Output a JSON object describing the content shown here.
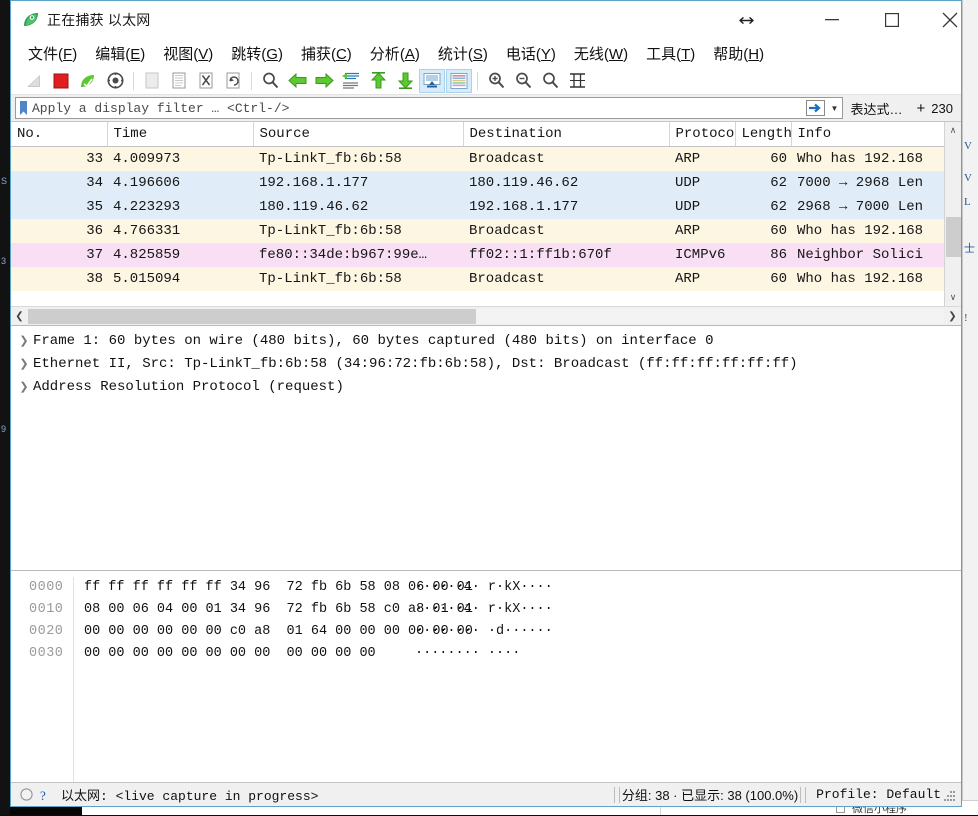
{
  "window": {
    "title": "正在捕获 以太网",
    "app_icon": "wireshark-fin-icon",
    "controls": {
      "resize": "↔",
      "minimize": "—",
      "maximize": "□",
      "close": "✕"
    }
  },
  "menubar": [
    {
      "label": "文件",
      "accel": "F"
    },
    {
      "label": "编辑",
      "accel": "E"
    },
    {
      "label": "视图",
      "accel": "V"
    },
    {
      "label": "跳转",
      "accel": "G"
    },
    {
      "label": "捕获",
      "accel": "C"
    },
    {
      "label": "分析",
      "accel": "A"
    },
    {
      "label": "统计",
      "accel": "S"
    },
    {
      "label": "电话",
      "accel": "Y"
    },
    {
      "label": "无线",
      "accel": "W"
    },
    {
      "label": "工具",
      "accel": "T"
    },
    {
      "label": "帮助",
      "accel": "H"
    }
  ],
  "toolbar": [
    {
      "name": "start-capture-icon",
      "disabled": true
    },
    {
      "name": "stop-capture-icon",
      "disabled": false
    },
    {
      "name": "restart-capture-icon",
      "disabled": false
    },
    {
      "name": "capture-options-icon",
      "disabled": false
    },
    {
      "name": "open-file-icon",
      "disabled": true
    },
    {
      "name": "save-file-icon",
      "disabled": false
    },
    {
      "name": "close-file-icon",
      "disabled": false
    },
    {
      "name": "reload-file-icon",
      "disabled": false
    },
    {
      "name": "find-packet-icon",
      "disabled": false
    },
    {
      "name": "go-back-icon",
      "disabled": false
    },
    {
      "name": "go-forward-icon",
      "disabled": false
    },
    {
      "name": "go-to-packet-icon",
      "disabled": false
    },
    {
      "name": "go-first-packet-icon",
      "disabled": false
    },
    {
      "name": "go-last-packet-icon",
      "disabled": false
    },
    {
      "name": "auto-scroll-icon",
      "selected": true
    },
    {
      "name": "colorize-packets-icon",
      "selected": true
    },
    {
      "name": "zoom-in-icon",
      "disabled": false
    },
    {
      "name": "zoom-out-icon",
      "disabled": false
    },
    {
      "name": "zoom-reset-icon",
      "disabled": false
    },
    {
      "name": "resize-columns-icon",
      "disabled": false
    }
  ],
  "filter": {
    "placeholder": "Apply a display filter … <Ctrl-/>",
    "value": "",
    "bookmark_icon": "bookmark-icon",
    "apply_icon": "apply-filter-arrow-icon",
    "dropdown_icon": "chevron-down-icon",
    "expression_label": "表达式…",
    "plus_label": "+",
    "count_label": "230"
  },
  "packet_list": {
    "columns": [
      "No.",
      "Time",
      "Source",
      "Destination",
      "Protocol",
      "Length",
      "Info"
    ],
    "rows": [
      {
        "no": "33",
        "time": "4.009973",
        "source": "Tp-LinkT_fb:6b:58",
        "destination": "Broadcast",
        "protocol": "ARP",
        "length": "60",
        "info": "Who has 192.168",
        "style": "r-arp"
      },
      {
        "no": "34",
        "time": "4.196606",
        "source": "192.168.1.177",
        "destination": "180.119.46.62",
        "protocol": "UDP",
        "length": "62",
        "info": "7000 → 2968 Len",
        "style": "r-udp"
      },
      {
        "no": "35",
        "time": "4.223293",
        "source": "180.119.46.62",
        "destination": "192.168.1.177",
        "protocol": "UDP",
        "length": "62",
        "info": "2968 → 7000 Len",
        "style": "r-udp"
      },
      {
        "no": "36",
        "time": "4.766331",
        "source": "Tp-LinkT_fb:6b:58",
        "destination": "Broadcast",
        "protocol": "ARP",
        "length": "60",
        "info": "Who has 192.168",
        "style": "r-arp"
      },
      {
        "no": "37",
        "time": "4.825859",
        "source": "fe80::34de:b967:99e…",
        "destination": "ff02::1:ff1b:670f",
        "protocol": "ICMPv6",
        "length": "86",
        "info": "Neighbor Solici",
        "style": "r-icmp6"
      },
      {
        "no": "38",
        "time": "5.015094",
        "source": "Tp-LinkT_fb:6b:58",
        "destination": "Broadcast",
        "protocol": "ARP",
        "length": "60",
        "info": "Who has 192.168",
        "style": "r-arp"
      }
    ]
  },
  "detail_pane": {
    "rows": [
      "Frame 1: 60 bytes on wire (480 bits), 60 bytes captured (480 bits) on interface 0",
      "Ethernet II, Src: Tp-LinkT_fb:6b:58 (34:96:72:fb:6b:58), Dst: Broadcast (ff:ff:ff:ff:ff:ff)",
      "Address Resolution Protocol (request)"
    ]
  },
  "bytes_pane": {
    "lines": [
      {
        "offset": "0000",
        "hex": "ff ff ff ff ff ff 34 96  72 fb 6b 58 08 06 00 01",
        "ascii": "······4· r·kX····"
      },
      {
        "offset": "0010",
        "hex": "08 00 06 04 00 01 34 96  72 fb 6b 58 c0 a8 01 01",
        "ascii": "······4· r·kX····"
      },
      {
        "offset": "0020",
        "hex": "00 00 00 00 00 00 c0 a8  01 64 00 00 00 00 00 00",
        "ascii": "········ ·d······"
      },
      {
        "offset": "0030",
        "hex": "00 00 00 00 00 00 00 00  00 00 00 00",
        "ascii": "········ ····"
      }
    ]
  },
  "status_bar": {
    "expert_icon": "expert-info-icon",
    "help_icon": "capture-help-icon",
    "interface_text": "以太网: <live capture in progress>",
    "counts_text": "分组: 38 · 已显示: 38 (100.0%)",
    "profile_text": "Profile: Default"
  },
  "background": {
    "bottom_window_label": "微信小程序",
    "right_strip_marks": [
      "V",
      "V",
      "L",
      "士",
      "!"
    ],
    "left_strip_marks": [
      "S",
      "3",
      "9"
    ]
  },
  "colors": {
    "accent": "#5aa4c8",
    "arp_row": "#fdf6e3",
    "udp_row": "#e0ecf8",
    "icmpv6_row": "#f8dff4",
    "toolbar_selected": "#d7ecfa",
    "stop_red": "#e02020",
    "go_green": "#5cc832"
  }
}
